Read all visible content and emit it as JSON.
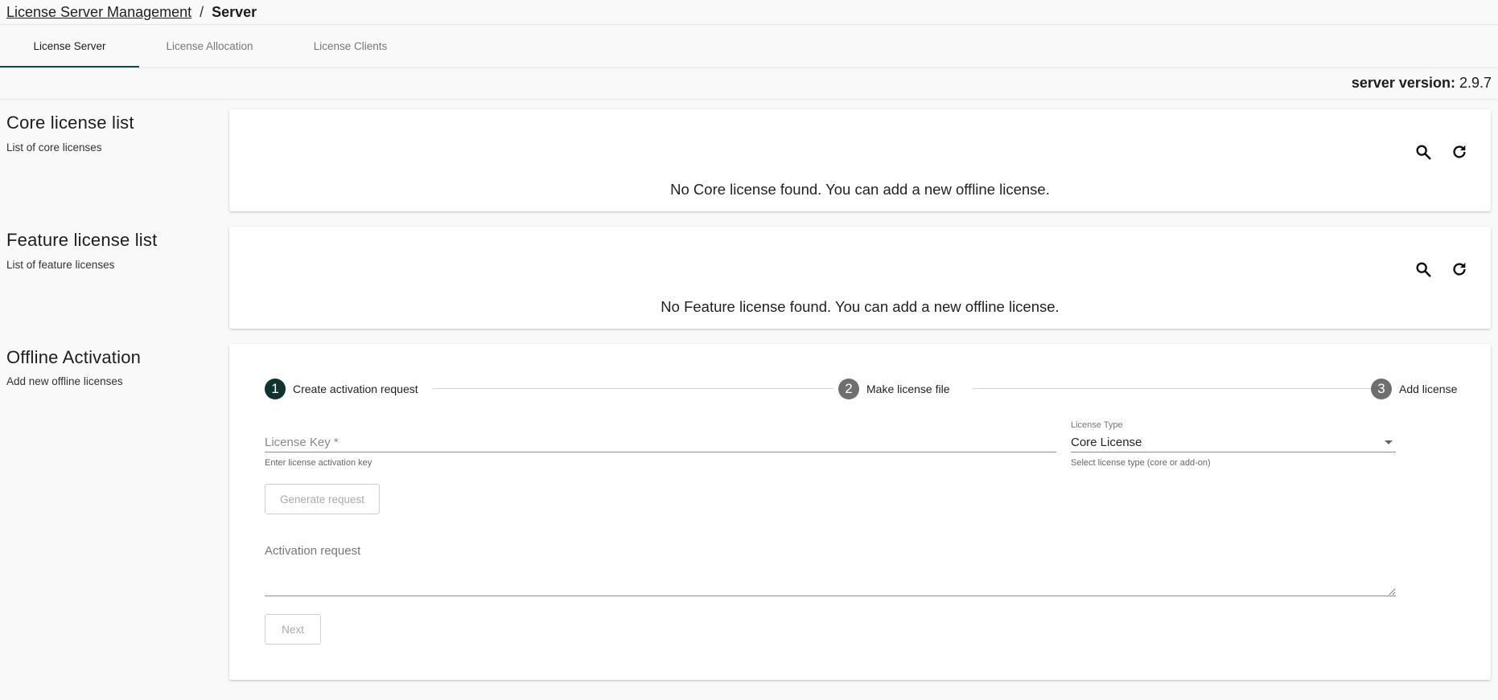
{
  "breadcrumb": {
    "parent": "License Server Management",
    "separator": "/",
    "current": "Server"
  },
  "tabs": [
    {
      "label": "License Server",
      "active": true
    },
    {
      "label": "License Allocation",
      "active": false
    },
    {
      "label": "License Clients",
      "active": false
    }
  ],
  "server_version": {
    "label": "server version:",
    "value": "2.9.7"
  },
  "core": {
    "title": "Core license list",
    "subtitle": "List of core licenses",
    "empty_message": "No Core license found. You can add a new offline license."
  },
  "feature": {
    "title": "Feature license list",
    "subtitle": "List of feature licenses",
    "empty_message": "No Feature license found. You can add a new offline license."
  },
  "offline": {
    "title": "Offline Activation",
    "subtitle": "Add new offline licenses",
    "steps": [
      {
        "number": "1",
        "label": "Create activation request",
        "active": true
      },
      {
        "number": "2",
        "label": "Make license file",
        "active": false
      },
      {
        "number": "3",
        "label": "Add license",
        "active": false
      }
    ],
    "license_key": {
      "placeholder": "License Key *",
      "value": "",
      "helper": "Enter license activation key"
    },
    "license_type": {
      "label": "License Type",
      "value": "Core License",
      "helper": "Select license type (core or add-on)"
    },
    "generate_label": "Generate request",
    "activation_request_label": "Activation request",
    "next_label": "Next"
  },
  "colors": {
    "accent": "#124a4a",
    "step_active": "#0e3330",
    "step_inactive": "#6f6f6f"
  },
  "icons": {
    "search": "search-icon",
    "refresh": "refresh-icon",
    "dropdown": "chevron-down-icon"
  }
}
